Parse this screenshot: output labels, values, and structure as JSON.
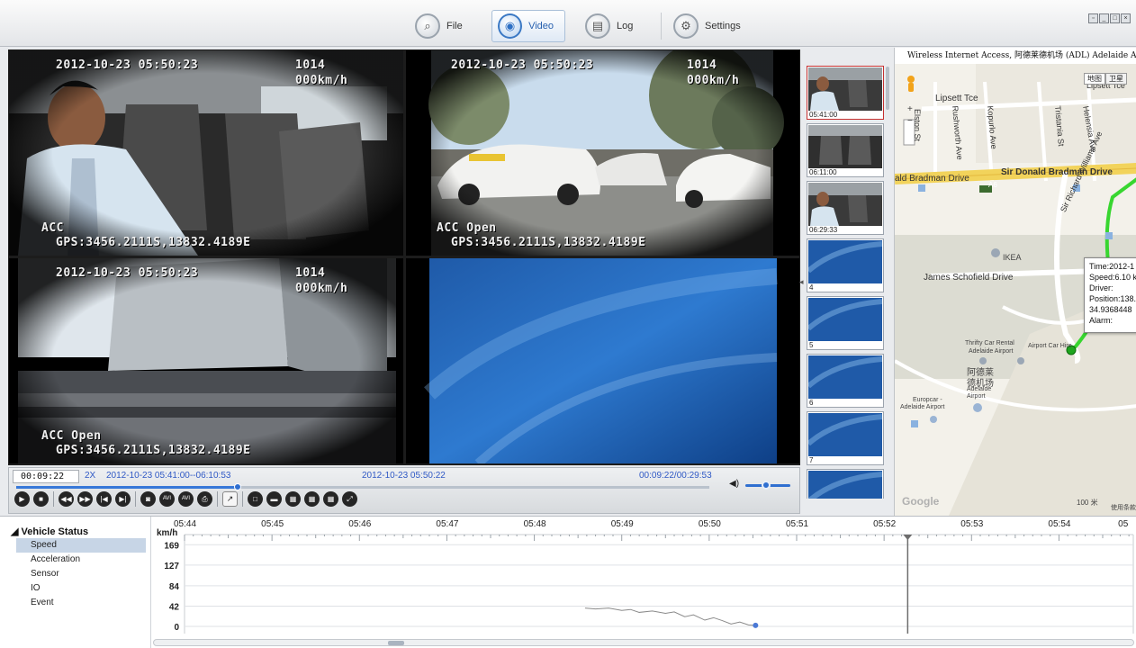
{
  "topbar": {
    "tabs": [
      {
        "label": "File",
        "icon": "magnifier-icon",
        "active": false
      },
      {
        "label": "Video",
        "icon": "camera-icon",
        "active": true
      },
      {
        "label": "Log",
        "icon": "log-icon",
        "active": false
      },
      {
        "label": "Settings",
        "icon": "gear-icon",
        "active": false
      }
    ]
  },
  "video": {
    "cells": [
      {
        "timestamp": "2012-10-23 05:50:23",
        "id": "1014",
        "speed": "000km/h",
        "acc": "ACC",
        "gps": "GPS:3456.2111S,13832.4189E",
        "scene": "driver"
      },
      {
        "timestamp": "2012-10-23 05:50:23",
        "id": "1014",
        "speed": "000km/h",
        "acc": "ACC Open",
        "gps": "GPS:3456.2111S,13832.4189E",
        "scene": "taxis"
      },
      {
        "timestamp": "2012-10-23 05:50:23",
        "id": "1014",
        "speed": "000km/h",
        "acc": "ACC Open",
        "gps": "GPS:3456.2111S,13832.4189E",
        "scene": "building"
      },
      {
        "scene": "no-signal"
      }
    ]
  },
  "thumbnails": [
    {
      "label": "05:41:00",
      "scene": "driver",
      "selected": true
    },
    {
      "label": "06:11:00",
      "scene": "seats",
      "selected": false
    },
    {
      "label": "06:29:33",
      "scene": "driver",
      "selected": false
    },
    {
      "label": "4",
      "scene": "blue",
      "selected": false
    },
    {
      "label": "5",
      "scene": "blue",
      "selected": false
    },
    {
      "label": "6",
      "scene": "blue",
      "selected": false
    },
    {
      "label": "7",
      "scene": "blue",
      "selected": false
    },
    {
      "label": "",
      "scene": "blue",
      "selected": false
    }
  ],
  "map": {
    "title": "Wireless Internet Access, 阿德莱德机场 (ADL) Adelaide Airport",
    "map_type_buttons": [
      "地图",
      "卫星"
    ],
    "streets": [
      "Lipsett Tce",
      "Sir Donald Bradman Drive",
      "ald Bradman Drive",
      "James Schofield Drive",
      "Sir Richard Williams Ave",
      "Elston St",
      "Rushworth Ave",
      "Kopurlo Ave",
      "Tristania St",
      "Helensia Ave",
      "Lipsett Tce"
    ],
    "places": [
      "IKEA",
      "Thrifty Car Rental",
      "Adelaide Airport",
      "Airport Car Hire",
      "阿德莱",
      "德机场",
      "Adelaide",
      "Airport",
      "Europcar -",
      "Adelaide Airport"
    ],
    "road_badge": "A6",
    "popup": {
      "lines": [
        "Time:2012-1",
        "Speed:6.10 k",
        "Driver:",
        "Position:138.",
        "34.9368448",
        "Alarm:"
      ]
    },
    "logo": "Google",
    "scale": "100 米",
    "terms": "使用条款",
    "zoom": [
      "+",
      "−"
    ]
  },
  "playback": {
    "current_time": "00:09:22",
    "speed": "2X",
    "range": "2012-10-23 05:41:00--06:10:53",
    "cursor_datetime": "2012-10-23 05:50:22",
    "elapsed": "00:09:22/00:29:53",
    "progress_fraction": 0.32,
    "volume_fraction": 0.45,
    "controls": [
      {
        "name": "play-icon",
        "glyph": "▶",
        "style": "round"
      },
      {
        "name": "stop-icon",
        "glyph": "■",
        "style": "round"
      },
      {
        "name": "rewind-icon",
        "glyph": "◀◀",
        "style": "round"
      },
      {
        "name": "fast-forward-icon",
        "glyph": "▶▶",
        "style": "round"
      },
      {
        "name": "previous-icon",
        "glyph": "|◀",
        "style": "round"
      },
      {
        "name": "next-icon",
        "glyph": "▶|",
        "style": "round"
      },
      {
        "name": "snapshot-icon",
        "glyph": "◙",
        "style": "round"
      },
      {
        "name": "avi-icon",
        "glyph": "AVI",
        "style": "round"
      },
      {
        "name": "avi-export-icon",
        "glyph": "AVI",
        "style": "round"
      },
      {
        "name": "print-icon",
        "glyph": "⎙",
        "style": "round"
      },
      {
        "name": "chart-icon",
        "glyph": "↗",
        "style": "square"
      },
      {
        "name": "layout-1-icon",
        "glyph": "□",
        "style": "round"
      },
      {
        "name": "layout-2-icon",
        "glyph": "▬",
        "style": "round"
      },
      {
        "name": "layout-4-icon",
        "glyph": "▦",
        "style": "round"
      },
      {
        "name": "layout-6-icon",
        "glyph": "▦",
        "style": "round"
      },
      {
        "name": "layout-9-icon",
        "glyph": "▦",
        "style": "round"
      },
      {
        "name": "fullscreen-icon",
        "glyph": "⤢",
        "style": "round"
      }
    ]
  },
  "status_tree": {
    "root": "Vehicle Status",
    "items": [
      {
        "label": "Speed",
        "selected": true
      },
      {
        "label": "Acceleration",
        "selected": false
      },
      {
        "label": "Sensor",
        "selected": false
      },
      {
        "label": "IO",
        "selected": false
      },
      {
        "label": "Event",
        "selected": false
      }
    ]
  },
  "chart_data": {
    "type": "line",
    "title": "",
    "xlabel": "",
    "ylabel": "km/h",
    "x_tick_labels": [
      "05:44",
      "05:45",
      "05:46",
      "05:47",
      "05:48",
      "05:49",
      "05:50",
      "05:51",
      "05:52",
      "05:53",
      "05:54",
      "05"
    ],
    "x_tick_minutes": [
      44.0,
      45.0,
      46.0,
      47.0,
      48.0,
      49.0,
      50.0,
      51.0,
      52.0,
      53.0,
      54.0,
      54.8
    ],
    "y_ticks": [
      0,
      42,
      84,
      127,
      169
    ],
    "ylim": [
      0,
      190
    ],
    "xlim_minutes": [
      44.0,
      54.85
    ],
    "cursor_minute": 52.27,
    "grid": true,
    "series": [
      {
        "x_minutes": [
          48.58,
          48.7,
          48.85,
          49.0,
          49.1,
          49.2,
          49.35,
          49.5,
          49.6,
          49.72,
          49.82,
          49.95,
          50.05,
          50.15,
          50.25,
          50.35,
          50.45,
          50.53
        ],
        "values": [
          38,
          36,
          38,
          33,
          35,
          29,
          32,
          27,
          30,
          20,
          24,
          13,
          18,
          12,
          5,
          9,
          3,
          2
        ],
        "color": "#8a8a8a"
      }
    ]
  }
}
